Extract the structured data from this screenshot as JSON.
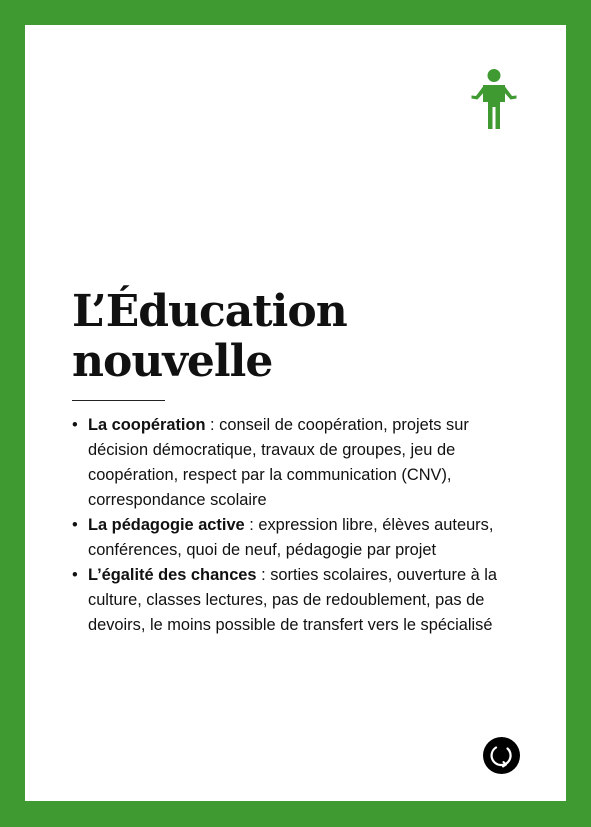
{
  "card": {
    "frame_color": "#3f9a32",
    "icons": {
      "top": "person-shrugging-icon",
      "bottom": "circular-arrow-icon"
    },
    "title_line_1": "L’Éducation",
    "title_line_2": "nouvelle",
    "bullet_char": "•",
    "items": [
      {
        "term": "La coopération",
        "text": " : conseil de coopération, projets sur décision démocratique, travaux de groupes, jeu de coopération, respect par la communication (CNV), correspondance scolaire"
      },
      {
        "term": "La pédagogie active",
        "text": " : expression libre, élèves auteurs, conférences, quoi de neuf, pédagogie par projet"
      },
      {
        "term": "L’égalité des chances",
        "text": " : sorties scolaires, ouverture à la culture, classes lectures, pas de redoublement, pas de devoirs, le moins possible de transfert vers le spécialisé"
      }
    ]
  }
}
